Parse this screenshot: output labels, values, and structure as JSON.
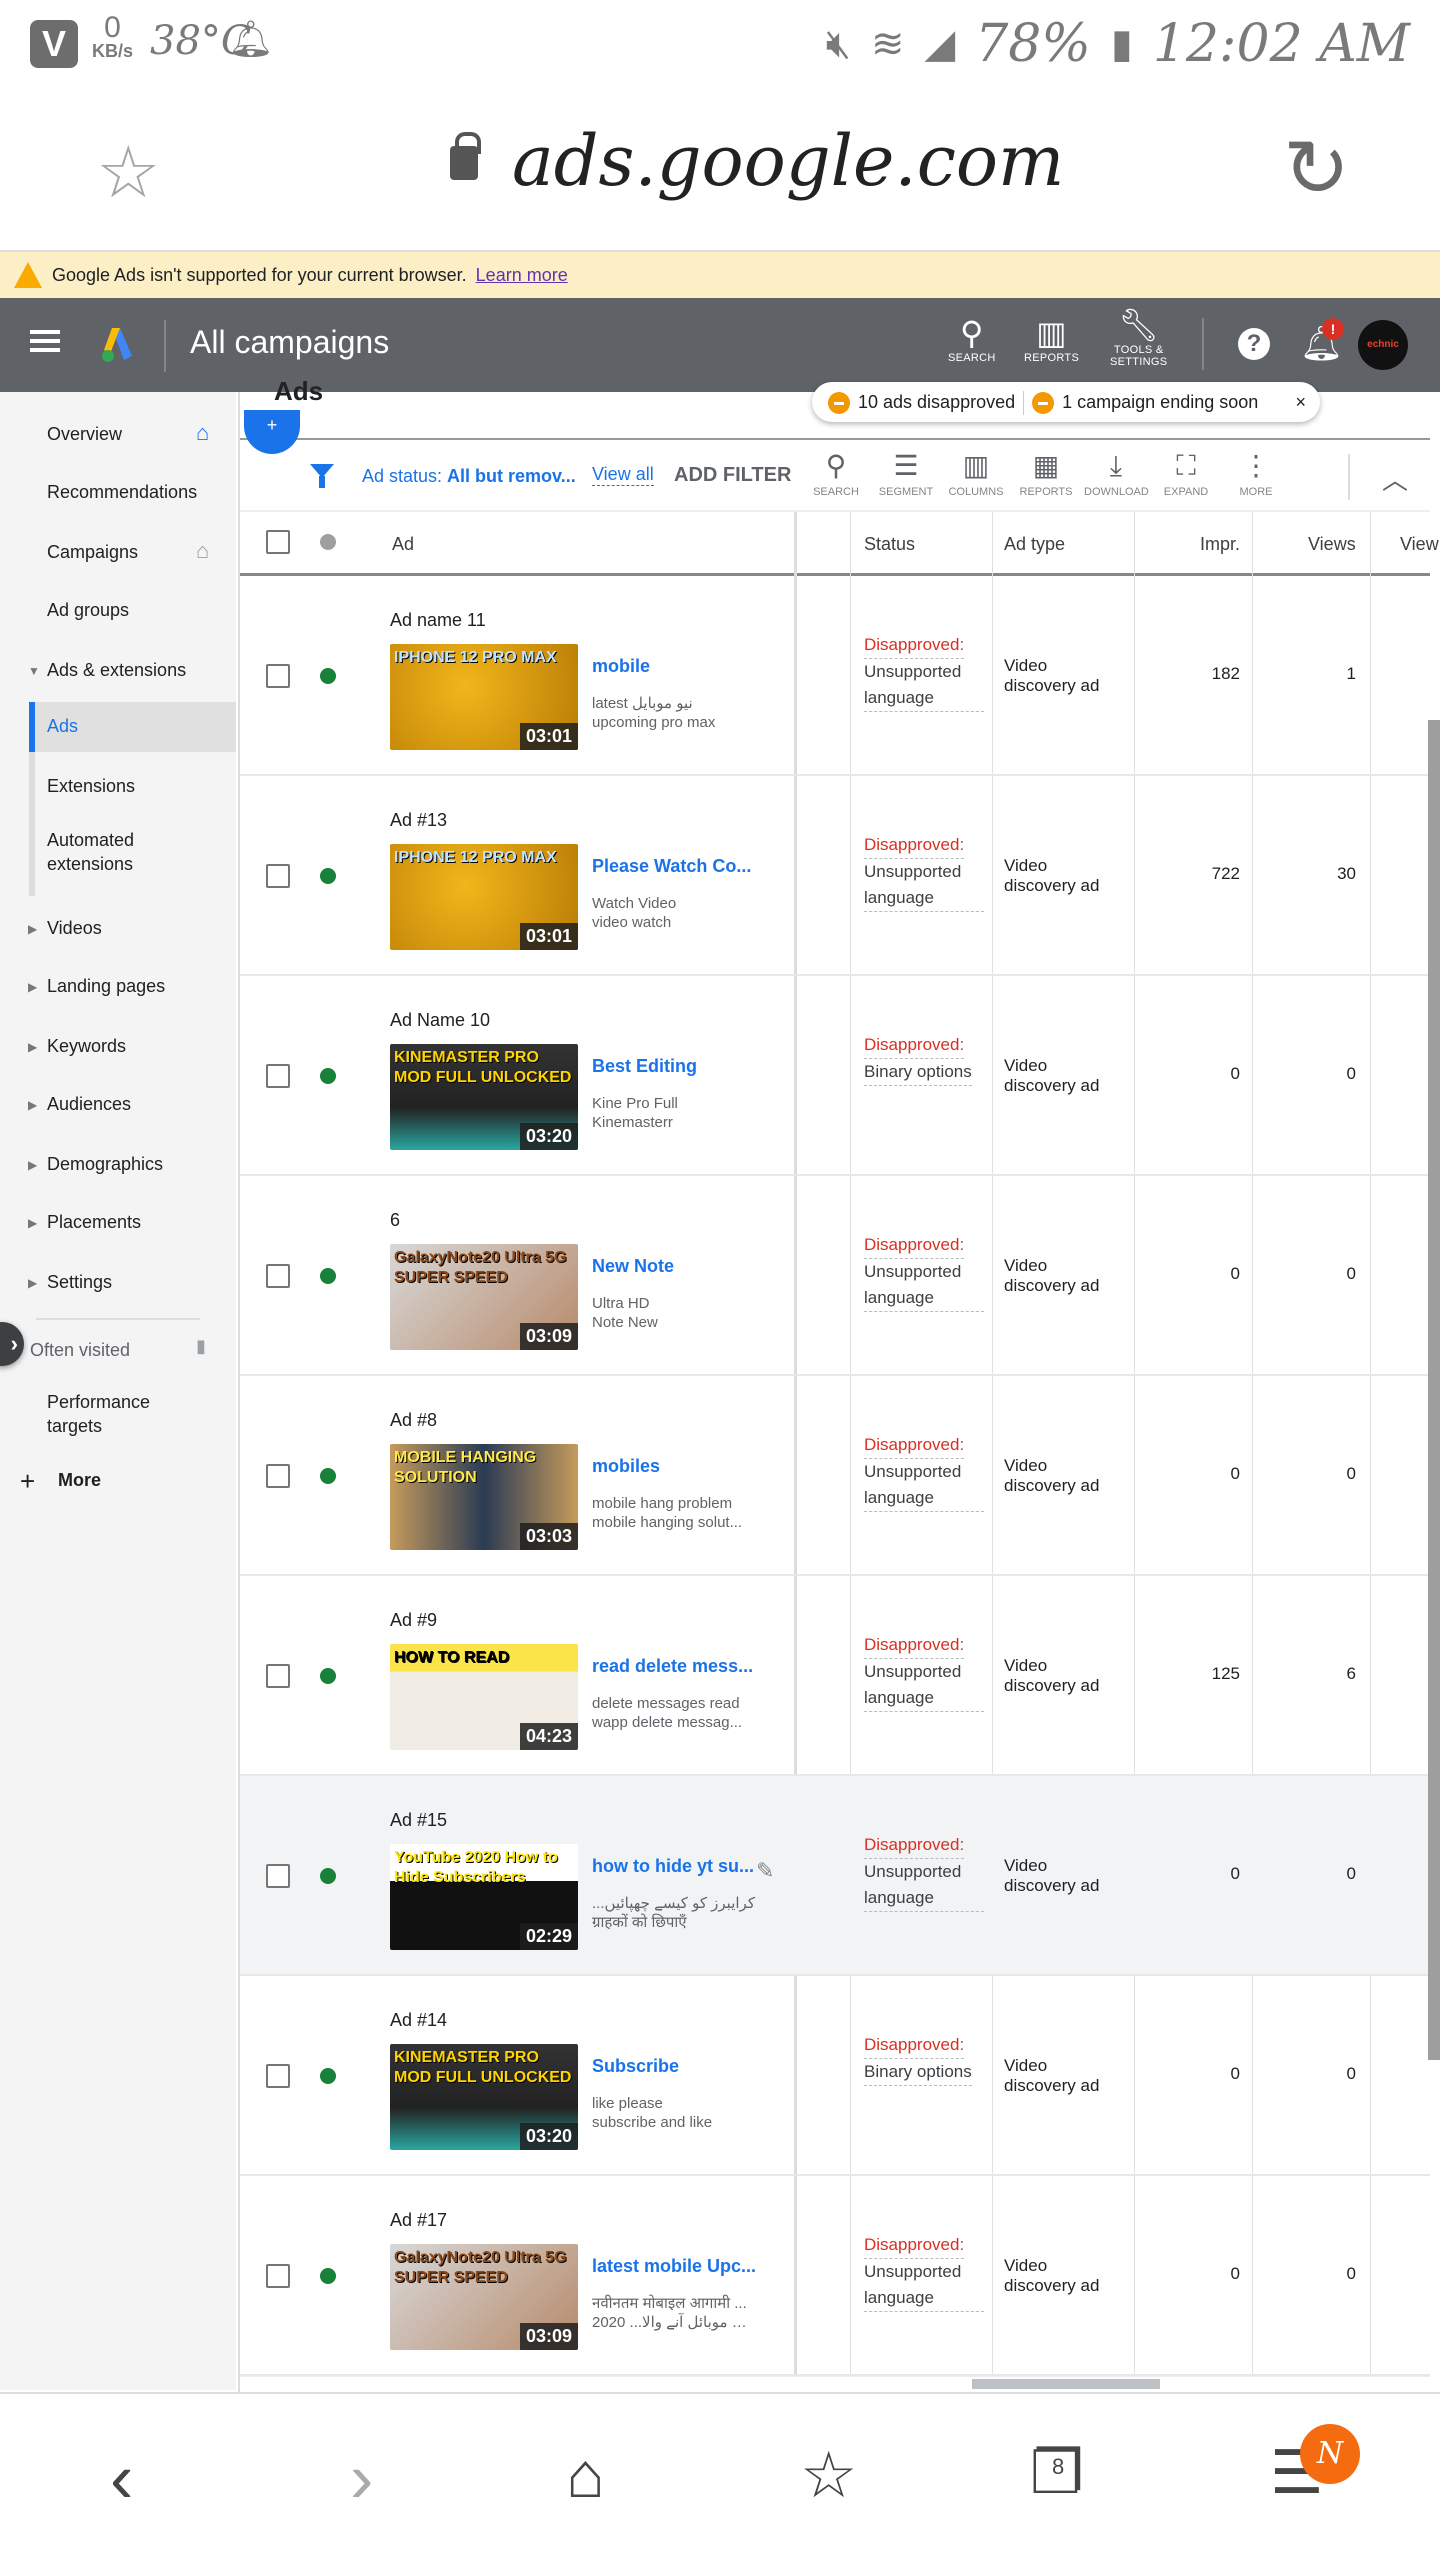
{
  "status_bar": {
    "app_icon": "V",
    "net_speed": "0",
    "net_unit": "KB/s",
    "temperature": "38°C",
    "battery": "78%",
    "time": "12:02 AM",
    "icons": [
      "mute-icon",
      "wifi-icon",
      "signal-icon",
      "battery-icon"
    ]
  },
  "browser": {
    "url": "ads.google.com",
    "warning_text": "Google Ads isn't supported for your current browser.",
    "warning_link": "Learn more"
  },
  "app_header": {
    "title": "All campaigns",
    "search_label": "SEARCH",
    "reports_label": "REPORTS",
    "tools_label_1": "TOOLS &",
    "tools_label_2": "SETTINGS",
    "avatar_text": "echnic"
  },
  "sidebar": {
    "items": [
      {
        "label": "Overview",
        "home": "blue"
      },
      {
        "label": "Recommendations"
      },
      {
        "label": "Campaigns",
        "home": "grey"
      },
      {
        "label": "Ad groups"
      },
      {
        "label": "Ads & extensions",
        "expanded": true
      },
      {
        "label": "Ads",
        "active": true
      },
      {
        "label": "Extensions"
      },
      {
        "label": "Automated extensions"
      },
      {
        "label": "Videos"
      },
      {
        "label": "Landing pages"
      },
      {
        "label": "Keywords"
      },
      {
        "label": "Audiences"
      },
      {
        "label": "Demographics"
      },
      {
        "label": "Placements"
      },
      {
        "label": "Settings"
      }
    ],
    "often_visited": "Often visited",
    "performance_targets": "Performance targets",
    "more": "More"
  },
  "main": {
    "section_title": "Ads",
    "notifications": {
      "item1": "10 ads disapproved",
      "item2": "1 campaign ending soon",
      "close": "×"
    },
    "filter": {
      "prefix": "Ad status: ",
      "value": "All but remov...",
      "view_all": "View all",
      "add_filter": "ADD FILTER"
    },
    "tools": [
      "SEARCH",
      "SEGMENT",
      "COLUMNS",
      "REPORTS",
      "DOWNLOAD",
      "EXPAND",
      "MORE"
    ],
    "columns": {
      "ad": "Ad",
      "status": "Status",
      "ad_type": "Ad type",
      "impr": "Impr.",
      "views": "Views",
      "view_rate": "View"
    },
    "rows": [
      {
        "name": "Ad name 11",
        "duration": "03:01",
        "thumb": "IPHONE 12 PRO MAX",
        "headline": "mobile",
        "desc1": "latest نیو موبایل",
        "desc2": "upcoming pro max",
        "status": "Disapproved:",
        "reason": "Unsupported language",
        "type": "Video discovery ad",
        "impr": "182",
        "views": "1"
      },
      {
        "name": "Ad #13",
        "duration": "03:01",
        "thumb": "IPHONE 12 PRO MAX",
        "headline": "Please Watch Co...",
        "desc1": "Watch Video",
        "desc2": "video watch",
        "status": "Disapproved:",
        "reason": "Unsupported language",
        "type": "Video discovery ad",
        "impr": "722",
        "views": "30"
      },
      {
        "name": "Ad Name 10",
        "duration": "03:20",
        "thumb": "KINEMASTER PRO MOD FULL UNLOCKED",
        "headline": "Best Editing",
        "desc1": "Kine Pro Full",
        "desc2": "Kinemasterr",
        "status": "Disapproved:",
        "reason": "Binary options",
        "type": "Video discovery ad",
        "impr": "0",
        "views": "0"
      },
      {
        "name": "6",
        "duration": "03:09",
        "thumb": "GalaxyNote20 Ultra 5G SUPER SPEED",
        "headline": "New Note",
        "desc1": "Ultra HD",
        "desc2": "Note New",
        "status": "Disapproved:",
        "reason": "Unsupported language",
        "type": "Video discovery ad",
        "impr": "0",
        "views": "0"
      },
      {
        "name": "Ad #8",
        "duration": "03:03",
        "thumb": "MOBILE HANGING SOLUTION",
        "headline": "mobiles",
        "desc1": "mobile hang problem",
        "desc2": "mobile hanging solut...",
        "status": "Disapproved:",
        "reason": "Unsupported language",
        "type": "Video discovery ad",
        "impr": "0",
        "views": "0"
      },
      {
        "name": "Ad #9",
        "duration": "04:23",
        "thumb": "HOW TO READ",
        "headline": "read delete mess...",
        "desc1": "delete messages read",
        "desc2": "wapp delete messag...",
        "status": "Disapproved:",
        "reason": "Unsupported language",
        "type": "Video discovery ad",
        "impr": "125",
        "views": "6"
      },
      {
        "name": "Ad #15",
        "duration": "02:29",
        "thumb": "YouTube 2020 How to Hide Subscribers",
        "headline": "how to hide yt su...",
        "desc1": "...کرایبرز کو کیسے چھپائیں",
        "desc2": "ग्राहकों को छिपाएँ",
        "status": "Disapproved:",
        "reason": "Unsupported language",
        "type": "Video discovery ad",
        "impr": "0",
        "views": "0",
        "highlighted": true
      },
      {
        "name": "Ad #14",
        "duration": "03:20",
        "thumb": "KINEMASTER PRO MOD FULL UNLOCKED",
        "headline": "Subscribe",
        "desc1": "like please",
        "desc2": "subscribe and like",
        "status": "Disapproved:",
        "reason": "Binary options",
        "type": "Video discovery ad",
        "impr": "0",
        "views": "0"
      },
      {
        "name": "Ad #17",
        "duration": "03:09",
        "thumb": "GalaxyNote20 Ultra 5G SUPER SPEED",
        "headline": "latest mobile Upc...",
        "desc1": "नवीनतम मोबाइल आगामी ...",
        "desc2": "2020 ...ترین موبائل آنے والا",
        "status": "Disapproved:",
        "reason": "Unsupported language",
        "type": "Video discovery ad",
        "impr": "0",
        "views": "0"
      }
    ]
  },
  "bottom_nav": {
    "menu_badge": "N",
    "tabs_count": "8"
  },
  "colors": {
    "accent": "#1a73e8",
    "appbar": "#5f6368",
    "disapproved": "#d93025",
    "enabled_dot": "#188038",
    "warning_bg": "#fcefc5",
    "notif_orange": "#f29900"
  }
}
